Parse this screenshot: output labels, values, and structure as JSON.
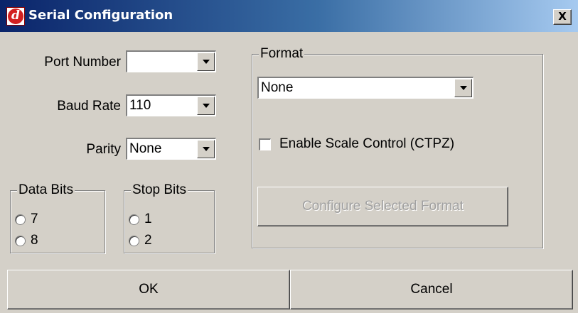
{
  "window": {
    "title": "Serial Configuration",
    "close_label": "X"
  },
  "port": {
    "label": "Port Number",
    "value": ""
  },
  "baud": {
    "label": "Baud Rate",
    "value": "110"
  },
  "parity": {
    "label": "Parity",
    "value": "None"
  },
  "data_bits": {
    "legend": "Data Bits",
    "options": [
      "7",
      "8"
    ]
  },
  "stop_bits": {
    "legend": "Stop Bits",
    "options": [
      "1",
      "2"
    ]
  },
  "format": {
    "legend": "Format",
    "value": "None",
    "scale_control_label": "Enable Scale Control (CTPZ)",
    "scale_control_checked": false,
    "configure_label": "Configure Selected Format",
    "configure_enabled": false
  },
  "buttons": {
    "ok": "OK",
    "cancel": "Cancel"
  },
  "icons": {
    "app": "app-logo-d-icon",
    "close": "close-icon",
    "dropdown": "chevron-down-icon"
  }
}
